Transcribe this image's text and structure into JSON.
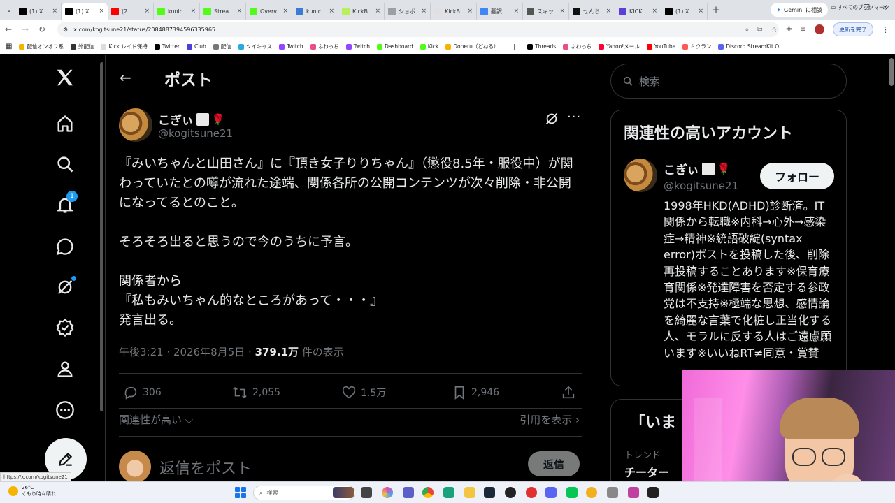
{
  "browser": {
    "tabs": [
      {
        "label": "(1) X",
        "color": "#000000",
        "active": false
      },
      {
        "label": "(1) X",
        "color": "#000000",
        "active": true
      },
      {
        "label": "(2",
        "color": "#ff0000",
        "active": false
      },
      {
        "label": "kunic",
        "color": "#53fc18",
        "active": false
      },
      {
        "label": "Strea",
        "color": "#53fc18",
        "active": false
      },
      {
        "label": "Overv",
        "color": "#53fc18",
        "active": false
      },
      {
        "label": "kunic",
        "color": "#3a7bd5",
        "active": false
      },
      {
        "label": "KickB",
        "color": "#b7f05a",
        "active": false
      },
      {
        "label": "ショボ",
        "color": "#9aa0a6",
        "active": false
      },
      {
        "label": "KickB",
        "color": "#e0e0e0",
        "active": false
      },
      {
        "label": "翻訳",
        "color": "#4285f4",
        "active": false
      },
      {
        "label": "スキッ",
        "color": "#555555",
        "active": false
      },
      {
        "label": "せんち",
        "color": "#111111",
        "active": false
      },
      {
        "label": "KICK",
        "color": "#5b3fd8",
        "active": false
      },
      {
        "label": "(1) X",
        "color": "#000000",
        "active": false
      }
    ],
    "gemini_label": "Gemini に相談",
    "url": "x.com/kogitsune21/status/2084887394596335965",
    "update_label": "更新を完了",
    "bookmarks": [
      {
        "label": "配信オンオフ系",
        "color": "#f4b400"
      },
      {
        "label": "外配信",
        "color": "#333333"
      },
      {
        "label": "Kick レイド保持",
        "color": "#dddddd"
      },
      {
        "label": "Twitter",
        "color": "#000000"
      },
      {
        "label": "Club",
        "color": "#4a3fd8"
      },
      {
        "label": "配信",
        "color": "#777777"
      },
      {
        "label": "ツイキャス",
        "color": "#2aa9e0"
      },
      {
        "label": "Twitch",
        "color": "#9146ff"
      },
      {
        "label": "ふわっち",
        "color": "#e84f8a"
      },
      {
        "label": "Twitch",
        "color": "#9146ff"
      },
      {
        "label": "Dashboard",
        "color": "#53fc18"
      },
      {
        "label": "Kick",
        "color": "#53fc18"
      },
      {
        "label": "Doneru（どねる）",
        "color": "#f4b400"
      },
      {
        "label": "|...",
        "color": "#ffffff"
      },
      {
        "label": "Threads",
        "color": "#000000"
      },
      {
        "label": "ふわっち",
        "color": "#e84f8a"
      },
      {
        "label": "Yahoo!メール",
        "color": "#ff0033"
      },
      {
        "label": "YouTube",
        "color": "#ff0000"
      },
      {
        "label": "ミクラン",
        "color": "#ff5a5a"
      },
      {
        "label": "Discord StreamKit O...",
        "color": "#5865f2"
      }
    ],
    "all_bookmarks_label": "すべてのブックマーク",
    "status_url": "https://x.com/kogitsune21"
  },
  "nav": {
    "notification_count": "1"
  },
  "header": {
    "back_symbol": "←",
    "title": "ポスト"
  },
  "post": {
    "display_name": "こぎぃ",
    "handle": "@kogitsune21",
    "body": "『みいちゃんと山田さん』に『頂き女子りりちゃん』（懲役8.5年・服役中）が関わっていたとの噂が流れた途端、関係各所の公開コンテンツが次々削除・非公開になってるとのこと。\n\nそろそろ出ると思うので今のうちに予言。\n\n関係者から\n『私もみいちゃん的なところがあって・・・』\n発言出る。",
    "time": "午後3:21 · 2026年8月5日 · ",
    "views": "379.1万",
    "views_suffix": " 件の表示",
    "replies": "306",
    "reposts": "2,055",
    "likes": "1.5万",
    "bookmarks": "2,946",
    "sort_label": "関連性が高い",
    "quotes_label": "引用を表示",
    "reply_placeholder": "返信をポスト",
    "reply_button": "返信"
  },
  "sidebar": {
    "search_placeholder": "検索",
    "related_title": "関連性の高いアカウント",
    "account_name": "こぎぃ",
    "account_handle": "@kogitsune21",
    "follow_label": "フォロー",
    "bio": "1998年HKD(ADHD)診断済。IT関係から転職※内科→心外→感染症→精神※統語破綻(syntax error)ポストを投稿した後、削除再投稿することあります※保育療育関係※発達障害を否定する参政党は不支持※極端な思想、感情論を綺麗な言葉で化粧し正当化する人、モラルに反する人はご遠慮願います※いいねRT≠同意・賞賛",
    "now_title": "「いま",
    "trend_label": "トレンド",
    "trend_name": "チーター"
  },
  "taskbar": {
    "temp": "26°C",
    "weather": "くもり時々晴れ",
    "search_label": "検索"
  },
  "colors": {
    "accent": "#1d9bf0",
    "bg": "#000000",
    "text": "#e7e9ea",
    "muted": "#71767b"
  }
}
